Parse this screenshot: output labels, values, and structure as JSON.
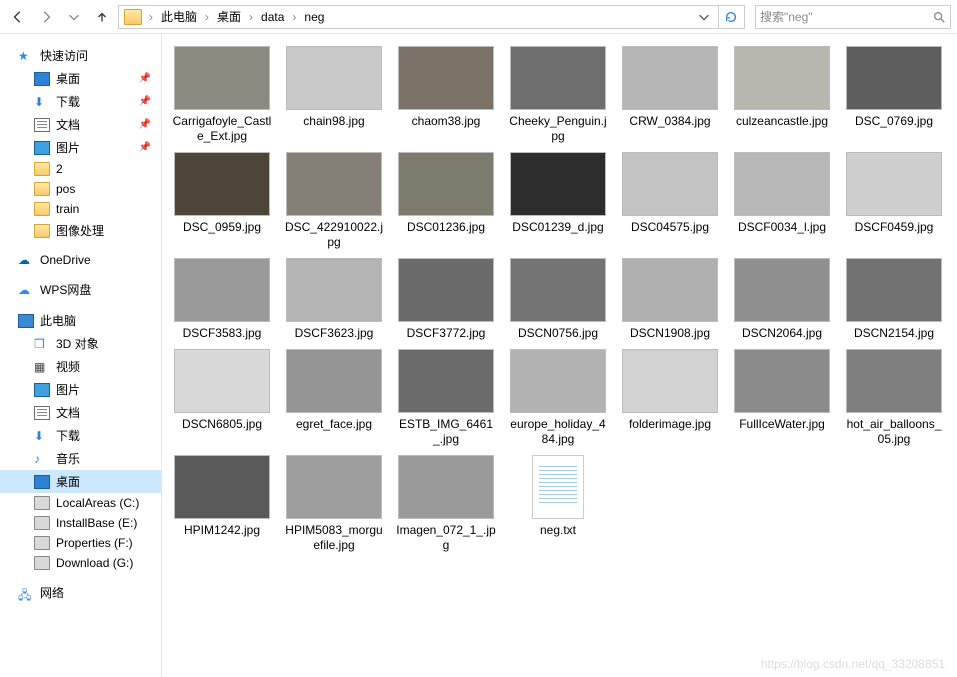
{
  "breadcrumb": [
    "此电脑",
    "桌面",
    "data",
    "neg"
  ],
  "search_placeholder": "搜索\"neg\"",
  "sidebar": {
    "quick": {
      "label": "快速访问",
      "items": [
        {
          "label": "桌面",
          "icon": "desktop",
          "pinned": true
        },
        {
          "label": "下载",
          "icon": "dl",
          "pinned": true
        },
        {
          "label": "文档",
          "icon": "doc",
          "pinned": true
        },
        {
          "label": "图片",
          "icon": "pic",
          "pinned": true
        },
        {
          "label": "2",
          "icon": "folder",
          "pinned": false
        },
        {
          "label": "pos",
          "icon": "folder",
          "pinned": false
        },
        {
          "label": "train",
          "icon": "folder",
          "pinned": false
        },
        {
          "label": "图像处理",
          "icon": "folder",
          "pinned": false
        }
      ]
    },
    "onedrive": "OneDrive",
    "wps": "WPS网盘",
    "pc": {
      "label": "此电脑",
      "items": [
        {
          "label": "3D 对象",
          "icon": "cube"
        },
        {
          "label": "视频",
          "icon": "vid"
        },
        {
          "label": "图片",
          "icon": "pic"
        },
        {
          "label": "文档",
          "icon": "doc"
        },
        {
          "label": "下载",
          "icon": "dl"
        },
        {
          "label": "音乐",
          "icon": "music"
        },
        {
          "label": "桌面",
          "icon": "desktop",
          "selected": true
        },
        {
          "label": "LocalAreas (C:)",
          "icon": "drive"
        },
        {
          "label": "InstallBase (E:)",
          "icon": "drive"
        },
        {
          "label": "Properties (F:)",
          "icon": "drive"
        },
        {
          "label": "Download (G:)",
          "icon": "drive"
        }
      ]
    },
    "network": "网络"
  },
  "files": [
    {
      "name": "Carrigafoyle_Castle_Ext.jpg",
      "bg": "#8a8a7e"
    },
    {
      "name": "chain98.jpg",
      "bg": "#c9c9c9"
    },
    {
      "name": "chaom38.jpg",
      "bg": "#7a7266"
    },
    {
      "name": "Cheeky_Penguin.jpg",
      "bg": "#6e6e6e"
    },
    {
      "name": "CRW_0384.jpg",
      "bg": "#b5b5b5"
    },
    {
      "name": "culzeancastle.jpg",
      "bg": "#b9b6b0"
    },
    {
      "name": "DSC_0769.jpg",
      "bg": "#5e5e5e"
    },
    {
      "name": "DSC_0959.jpg",
      "bg": "#4d4538"
    },
    {
      "name": "DSC_422910022.jpg",
      "bg": "#858076"
    },
    {
      "name": "DSC01236.jpg",
      "bg": "#7d7a6e"
    },
    {
      "name": "DSC01239_d.jpg",
      "bg": "#2d2d2d"
    },
    {
      "name": "DSC04575.jpg",
      "bg": "#c3c3c3"
    },
    {
      "name": "DSCF0034_l.jpg",
      "bg": "#b8b8b8"
    },
    {
      "name": "DSCF0459.jpg",
      "bg": "#cfcfcf"
    },
    {
      "name": "DSCF3583.jpg",
      "bg": "#9a9a9a"
    },
    {
      "name": "DSCF3623.jpg",
      "bg": "#b4b4b4"
    },
    {
      "name": "DSCF3772.jpg",
      "bg": "#6a6a6a"
    },
    {
      "name": "DSCN0756.jpg",
      "bg": "#747474"
    },
    {
      "name": "DSCN1908.jpg",
      "bg": "#b0b0b0"
    },
    {
      "name": "DSCN2064.jpg",
      "bg": "#8f8f8f"
    },
    {
      "name": "DSCN2154.jpg",
      "bg": "#727272"
    },
    {
      "name": "DSCN6805.jpg",
      "bg": "#d8d8d8"
    },
    {
      "name": "egret_face.jpg",
      "bg": "#949494"
    },
    {
      "name": "ESTB_IMG_6461_.jpg",
      "bg": "#6b6b6b"
    },
    {
      "name": "europe_holiday_484.jpg",
      "bg": "#b2b2b2"
    },
    {
      "name": "folderimage.jpg",
      "bg": "#d2d2d2"
    },
    {
      "name": "FullIceWater.jpg",
      "bg": "#8b8b8b"
    },
    {
      "name": "hot_air_balloons_05.jpg",
      "bg": "#7e7e7e"
    },
    {
      "name": "HPIM1242.jpg",
      "bg": "#5a5a5a"
    },
    {
      "name": "HPIM5083_morguefile.jpg",
      "bg": "#9e9e9e"
    },
    {
      "name": "Imagen_072_1_.jpg",
      "bg": "#9a9a9a"
    },
    {
      "name": "neg.txt",
      "type": "txt"
    }
  ],
  "watermark": "https://blog.csdn.net/qq_33208851"
}
